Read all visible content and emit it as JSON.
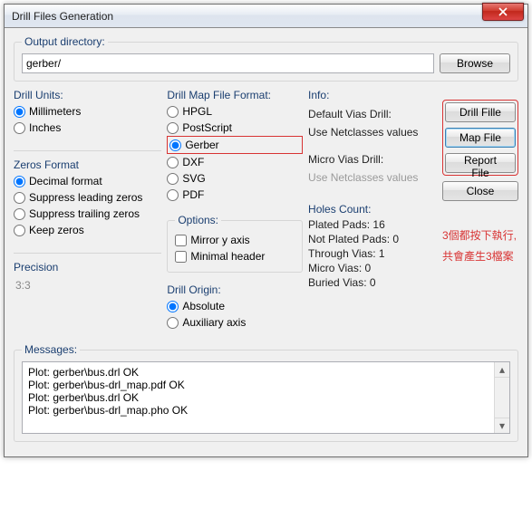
{
  "titlebar": {
    "title": "Drill Files Generation"
  },
  "output": {
    "legend": "Output directory:",
    "value": "gerber/",
    "browse": "Browse"
  },
  "units": {
    "legend": "Drill Units:",
    "mm": "Millimeters",
    "in": "Inches"
  },
  "zeros": {
    "legend": "Zeros Format",
    "decimal": "Decimal format",
    "supLead": "Suppress leading zeros",
    "supTrail": "Suppress trailing zeros",
    "keep": "Keep zeros"
  },
  "precision": {
    "legend": "Precision",
    "value": "3:3"
  },
  "map": {
    "legend": "Drill Map File Format:",
    "hpgl": "HPGL",
    "ps": "PostScript",
    "gerber": "Gerber",
    "dxf": "DXF",
    "svg": "SVG",
    "pdf": "PDF"
  },
  "options": {
    "legend": "Options:",
    "mirror": "Mirror y axis",
    "minhdr": "Minimal header"
  },
  "origin": {
    "legend": "Drill Origin:",
    "abs": "Absolute",
    "aux": "Auxiliary axis"
  },
  "info": {
    "legend": "Info:",
    "defVias": "Default Vias Drill:",
    "useNet1": "Use Netclasses values",
    "microVias": "Micro Vias Drill:",
    "useNet2": "Use Netclasses values",
    "holesLegend": "Holes Count:",
    "plated": "Plated Pads: 16",
    "notPlated": "Not Plated Pads: 0",
    "through": "Through Vias: 1",
    "micro": "Micro Vias: 0",
    "buried": "Buried Vias: 0"
  },
  "buttons": {
    "drill": "Drill Fille",
    "map": "Map File",
    "report": "Report File",
    "close": "Close"
  },
  "annotation": {
    "l1": "3個都按下執行,",
    "l2": "共會產生3檔案"
  },
  "messages": {
    "legend": "Messages:",
    "m1": "Plot: gerber\\bus.drl OK",
    "m2": "Plot: gerber\\bus-drl_map.pdf OK",
    "m3": "Plot: gerber\\bus.drl OK",
    "m4": "Plot: gerber\\bus-drl_map.pho OK"
  }
}
